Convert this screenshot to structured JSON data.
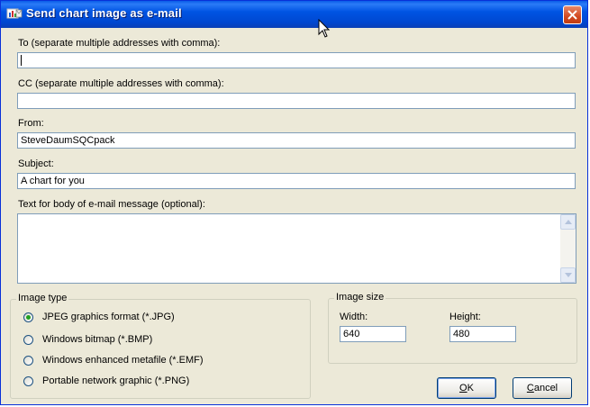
{
  "window": {
    "title": "Send chart image as e-mail"
  },
  "fields": {
    "to": {
      "label": "To (separate multiple addresses with comma):",
      "value": ""
    },
    "cc": {
      "label": "CC (separate multiple addresses with comma):",
      "value": ""
    },
    "from": {
      "label": "From:",
      "value": "SteveDaumSQCpack"
    },
    "subject": {
      "label": "Subject:",
      "value": "A chart for you"
    },
    "body": {
      "label": "Text for body of e-mail message (optional):",
      "value": ""
    }
  },
  "image_type": {
    "title": "Image type",
    "options": [
      {
        "label": "JPEG graphics format (*.JPG)",
        "checked": true
      },
      {
        "label": "Windows bitmap (*.BMP)",
        "checked": false
      },
      {
        "label": "Windows enhanced metafile (*.EMF)",
        "checked": false
      },
      {
        "label": "Portable network graphic (*.PNG)",
        "checked": false
      }
    ]
  },
  "image_size": {
    "title": "Image size",
    "width_label": "Width:",
    "width_value": "640",
    "height_label": "Height:",
    "height_value": "480"
  },
  "buttons": {
    "ok_first": "O",
    "ok_rest": "K",
    "cancel_first": "C",
    "cancel_rest": "ancel"
  }
}
